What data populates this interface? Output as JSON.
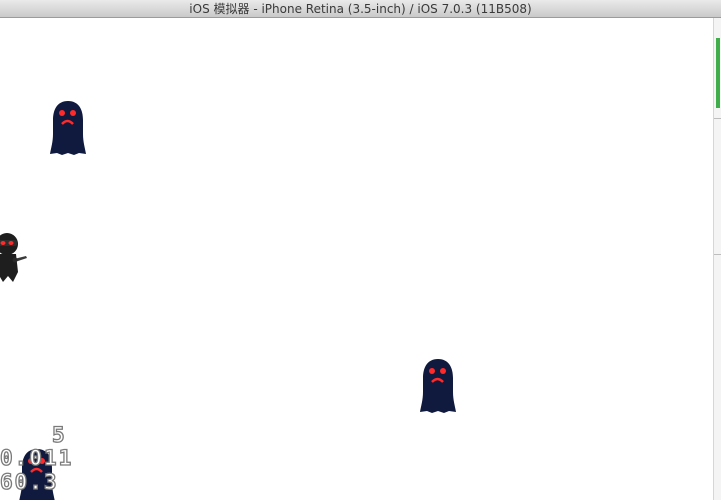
{
  "window": {
    "title": "iOS 模拟器 - iPhone Retina (3.5-inch) / iOS 7.0.3 (11B508)"
  },
  "game": {
    "sprites": [
      {
        "kind": "monster",
        "icon": "ghost-monster-icon",
        "color": "#0f1a3e",
        "eye_color": "#ff2a2a"
      },
      {
        "kind": "player",
        "icon": "ninja-player-icon",
        "color": "#1e1e1e",
        "eye_color": "#ff2a2a"
      },
      {
        "kind": "monster",
        "icon": "ghost-monster-icon",
        "color": "#0f1a3e",
        "eye_color": "#ff2a2a"
      },
      {
        "kind": "monster",
        "icon": "ghost-monster-icon",
        "color": "#0f1a3e",
        "eye_color": "#ff2a2a"
      }
    ]
  },
  "debug_stats": {
    "draw_calls": "5",
    "frame_time": "0.011",
    "fps": "60.3",
    "text_color": "#ffffff",
    "outline_color": "#7a7a7a"
  }
}
